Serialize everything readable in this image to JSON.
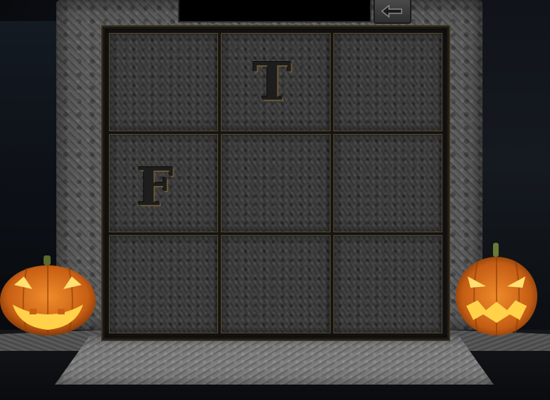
{
  "top_bar": {
    "display_text": "",
    "back_icon": "back-arrow-icon"
  },
  "grid": {
    "rows": 3,
    "cols": 3,
    "tiles": [
      {
        "row": 1,
        "col": 1,
        "letter": ""
      },
      {
        "row": 1,
        "col": 2,
        "letter": "T"
      },
      {
        "row": 1,
        "col": 3,
        "letter": ""
      },
      {
        "row": 2,
        "col": 1,
        "letter": "F"
      },
      {
        "row": 2,
        "col": 2,
        "letter": ""
      },
      {
        "row": 2,
        "col": 3,
        "letter": ""
      },
      {
        "row": 3,
        "col": 1,
        "letter": ""
      },
      {
        "row": 3,
        "col": 2,
        "letter": ""
      },
      {
        "row": 3,
        "col": 3,
        "letter": ""
      }
    ]
  },
  "decorations": {
    "left": "jack-o-lantern-icon",
    "right": "jack-o-lantern-icon"
  },
  "colors": {
    "pumpkin_orange": "#d9731c",
    "pumpkin_glow": "#ffd84a",
    "stone": "#555555",
    "tile_border": "#5b4a2a"
  }
}
